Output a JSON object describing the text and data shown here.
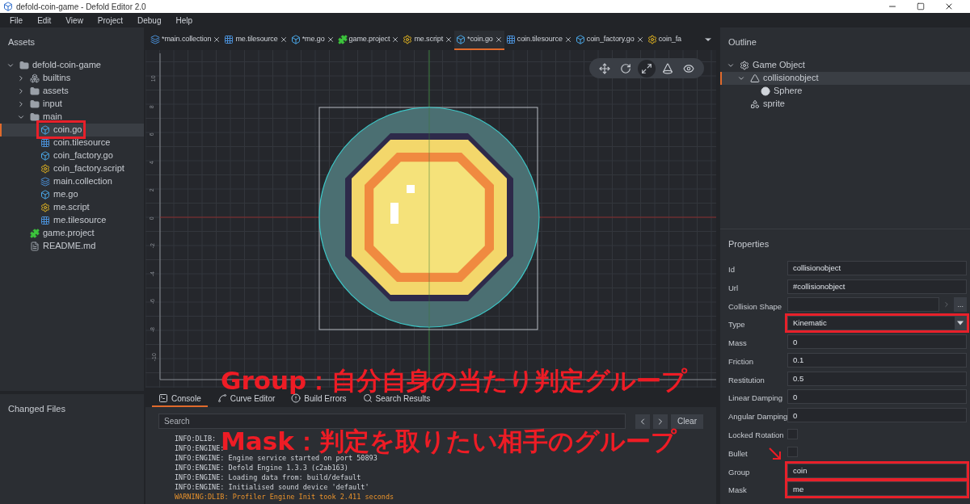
{
  "window": {
    "title": "defold-coin-game - Defold Editor 2.0"
  },
  "menu": [
    "File",
    "Edit",
    "View",
    "Project",
    "Debug",
    "Help"
  ],
  "assets": {
    "title": "Assets",
    "tree": [
      {
        "label": "defold-coin-game",
        "kind": "folder",
        "expanded": true,
        "selected": false,
        "annotated": false,
        "children": [
          {
            "label": "builtins",
            "kind": "builtins",
            "expanded": false,
            "selected": false,
            "annotated": false
          },
          {
            "label": "assets",
            "kind": "folder",
            "expanded": false,
            "selected": false,
            "annotated": false
          },
          {
            "label": "input",
            "kind": "folder",
            "expanded": false,
            "selected": false,
            "annotated": false
          },
          {
            "label": "main",
            "kind": "folder",
            "expanded": true,
            "selected": false,
            "annotated": false,
            "children": [
              {
                "label": "coin.go",
                "kind": "go",
                "selected": true,
                "annotated": true
              },
              {
                "label": "coin.tilesource",
                "kind": "tilesource",
                "selected": false,
                "annotated": false
              },
              {
                "label": "coin_factory.go",
                "kind": "go",
                "selected": false,
                "annotated": false
              },
              {
                "label": "coin_factory.script",
                "kind": "script",
                "selected": false,
                "annotated": false
              },
              {
                "label": "main.collection",
                "kind": "collection",
                "selected": false,
                "annotated": false
              },
              {
                "label": "me.go",
                "kind": "go",
                "selected": false,
                "annotated": false
              },
              {
                "label": "me.script",
                "kind": "script",
                "selected": false,
                "annotated": false
              },
              {
                "label": "me.tilesource",
                "kind": "tilesource",
                "selected": false,
                "annotated": false
              }
            ]
          },
          {
            "label": "game.project",
            "kind": "project",
            "selected": false,
            "annotated": false
          },
          {
            "label": "README.md",
            "kind": "file",
            "selected": false,
            "annotated": false
          }
        ]
      }
    ]
  },
  "changed_files": {
    "title": "Changed Files"
  },
  "tabs": [
    {
      "label": "*main.collection",
      "kind": "collection",
      "selected": false
    },
    {
      "label": "me.tilesource",
      "kind": "tilesource",
      "selected": false
    },
    {
      "label": "*me.go",
      "kind": "go",
      "selected": false
    },
    {
      "label": "game.project",
      "kind": "project",
      "selected": false
    },
    {
      "label": "me.script",
      "kind": "script",
      "selected": false
    },
    {
      "label": "*coin.go",
      "kind": "go",
      "selected": true
    },
    {
      "label": "coin.tilesource",
      "kind": "tilesource",
      "selected": false
    },
    {
      "label": "coin_factory.go",
      "kind": "go",
      "selected": false
    },
    {
      "label": "coin_fa",
      "kind": "script",
      "selected": false
    }
  ],
  "scene": {
    "ruler_labels": [
      "10",
      "8",
      "6",
      "4",
      "2",
      "0",
      "-2",
      "-4",
      "-6",
      "-8",
      "-10"
    ],
    "tools": [
      {
        "kind": "move",
        "selected": false
      },
      {
        "kind": "rotate",
        "selected": false
      },
      {
        "kind": "scale",
        "selected": true
      },
      {
        "kind": "perspective",
        "selected": false
      },
      {
        "kind": "visibility",
        "selected": false
      }
    ]
  },
  "bottom_tabs": [
    {
      "label": "Console",
      "kind": "console",
      "selected": true
    },
    {
      "label": "Curve Editor",
      "kind": "curve",
      "selected": false
    },
    {
      "label": "Build Errors",
      "kind": "errors",
      "selected": false
    },
    {
      "label": "Search Results",
      "kind": "search",
      "selected": false
    }
  ],
  "console": {
    "search": {
      "placeholder": "Search"
    },
    "clear": "Clear",
    "lines": [
      {
        "text": "INFO:DLIB:",
        "kind": "info"
      },
      {
        "text": "INFO:ENGINE:",
        "kind": "info"
      },
      {
        "text": "INFO:ENGINE: Engine service started on port 50893",
        "kind": "info"
      },
      {
        "text": "INFO:ENGINE: Defold Engine 1.3.3 (c2ab163)",
        "kind": "info"
      },
      {
        "text": "INFO:ENGINE: Loading data from: build/default",
        "kind": "info"
      },
      {
        "text": "INFO:ENGINE: Initialised sound device 'default'",
        "kind": "info"
      },
      {
        "text": "WARNING:DLIB: Profiler Engine Init took 2.411 seconds",
        "kind": "warning"
      }
    ]
  },
  "outline": {
    "title": "Outline",
    "tree": [
      {
        "label": "Game Object",
        "kind": "gameobject",
        "expanded": true,
        "selected": false,
        "children": [
          {
            "label": "collisionobject",
            "kind": "collision",
            "expanded": true,
            "selected": true,
            "children": [
              {
                "label": "Sphere",
                "kind": "sphere",
                "selected": false
              }
            ]
          },
          {
            "label": "sprite",
            "kind": "sprite",
            "selected": false
          }
        ]
      }
    ]
  },
  "properties": {
    "title": "Properties",
    "rows": [
      {
        "label": "Id",
        "kind": "text",
        "value": "collisionobject",
        "annotated": false
      },
      {
        "label": "Url",
        "kind": "text",
        "value": "#collisionobject",
        "annotated": false
      },
      {
        "label": "Collision Shape",
        "kind": "resource",
        "button": "...",
        "annotated": false
      },
      {
        "label": "Type",
        "kind": "dropdown",
        "value": "Kinematic",
        "annotated": true
      },
      {
        "label": "Mass",
        "kind": "text",
        "value": "0",
        "annotated": false
      },
      {
        "label": "Friction",
        "kind": "text",
        "value": "0.1",
        "annotated": false
      },
      {
        "label": "Restitution",
        "kind": "text",
        "value": "0.5",
        "annotated": false
      },
      {
        "label": "Linear Damping",
        "kind": "text",
        "value": "0",
        "annotated": false
      },
      {
        "label": "Angular Damping",
        "kind": "text",
        "value": "0",
        "annotated": false
      },
      {
        "label": "Locked Rotation",
        "kind": "checkbox",
        "checked": false,
        "annotated": false
      },
      {
        "label": "Bullet",
        "kind": "checkbox",
        "checked": false,
        "annotated": false
      },
      {
        "label": "Group",
        "kind": "text",
        "value": "coin",
        "annotated": true
      },
      {
        "label": "Mask",
        "kind": "text",
        "value": "me",
        "annotated": true
      }
    ]
  },
  "annotations": [
    "Group：自分自身の当たり判定グループ",
    "Mask：判定を取りたい相手のグループ"
  ]
}
